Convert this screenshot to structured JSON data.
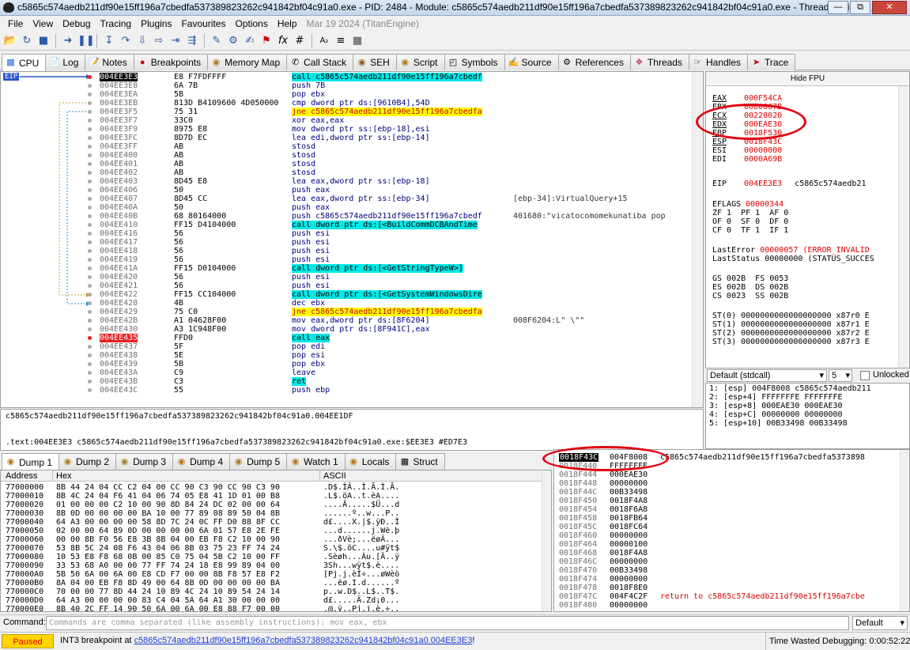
{
  "window": {
    "title": "c5865c574aedb211df90e15ff196a7cbedfa537389823262c941842bf04c91a0.exe - PID: 2484 - Module: c5865c574aedb211df90e15ff196a7cbedfa537389823262c941842bf04c91a0.exe - Thread: Main T...",
    "buttons": [
      "—",
      "⧉",
      "✕"
    ]
  },
  "menu": [
    "File",
    "View",
    "Debug",
    "Tracing",
    "Plugins",
    "Favourites",
    "Options",
    "Help"
  ],
  "menu_date": "Mar 19 2024 (TitanEngine)",
  "tabs": [
    {
      "label": "CPU",
      "icon": "cpu-icon"
    },
    {
      "label": "Log",
      "icon": "log-icon"
    },
    {
      "label": "Notes",
      "icon": "notes-icon"
    },
    {
      "label": "Breakpoints",
      "icon": "breakpoint-icon"
    },
    {
      "label": "Memory Map",
      "icon": "memory-icon"
    },
    {
      "label": "Call Stack",
      "icon": "callstack-icon"
    },
    {
      "label": "SEH",
      "icon": "seh-icon"
    },
    {
      "label": "Script",
      "icon": "script-icon"
    },
    {
      "label": "Symbols",
      "icon": "symbols-icon"
    },
    {
      "label": "Source",
      "icon": "source-icon"
    },
    {
      "label": "References",
      "icon": "references-icon"
    },
    {
      "label": "Threads",
      "icon": "threads-icon"
    },
    {
      "label": "Handles",
      "icon": "handles-icon"
    },
    {
      "label": "Trace",
      "icon": "trace-icon"
    }
  ],
  "eip_label": "EIP",
  "disasm": [
    {
      "addr": "004EE3E3",
      "bytes": "E8 F7FDFFFF",
      "instr": "call c5865c574aedb211df90e15ff196a7cbedf",
      "kind": "call",
      "cmt": "",
      "mark": "cur"
    },
    {
      "addr": "004EE3E8",
      "bytes": "6A 7B",
      "instr": "push 7B",
      "kind": "",
      "cmt": ""
    },
    {
      "addr": "004EE3EA",
      "bytes": "5B",
      "instr": "pop ebx",
      "kind": "",
      "cmt": ""
    },
    {
      "addr": "004EE3EB",
      "bytes": "813D B4109600 4D050000",
      "instr": "cmp dword ptr ds:[9610B4],54D",
      "kind": "",
      "cmt": ""
    },
    {
      "addr": "004EE3F5",
      "bytes": "75 31",
      "instr": "jne c5865c574aedb211df90e15ff196a7cbedfa",
      "kind": "jmp",
      "cmt": ""
    },
    {
      "addr": "004EE3F7",
      "bytes": "33C0",
      "instr": "xor eax,eax",
      "kind": "",
      "cmt": ""
    },
    {
      "addr": "004EE3F9",
      "bytes": "8975 E8",
      "instr": "mov dword ptr ss:[ebp-18],esi",
      "kind": "",
      "cmt": ""
    },
    {
      "addr": "004EE3FC",
      "bytes": "8D7D EC",
      "instr": "lea edi,dword ptr ss:[ebp-14]",
      "kind": "",
      "cmt": ""
    },
    {
      "addr": "004EE3FF",
      "bytes": "AB",
      "instr": "stosd",
      "kind": "",
      "cmt": ""
    },
    {
      "addr": "004EE400",
      "bytes": "AB",
      "instr": "stosd",
      "kind": "",
      "cmt": ""
    },
    {
      "addr": "004EE401",
      "bytes": "AB",
      "instr": "stosd",
      "kind": "",
      "cmt": ""
    },
    {
      "addr": "004EE402",
      "bytes": "AB",
      "instr": "stosd",
      "kind": "",
      "cmt": ""
    },
    {
      "addr": "004EE403",
      "bytes": "8D45 E8",
      "instr": "lea eax,dword ptr ss:[ebp-18]",
      "kind": "",
      "cmt": ""
    },
    {
      "addr": "004EE406",
      "bytes": "50",
      "instr": "push eax",
      "kind": "",
      "cmt": ""
    },
    {
      "addr": "004EE407",
      "bytes": "8D45 CC",
      "instr": "lea eax,dword ptr ss:[ebp-34]",
      "kind": "",
      "cmt": "[ebp-34]:VirtualQuery+15"
    },
    {
      "addr": "004EE40A",
      "bytes": "50",
      "instr": "push eax",
      "kind": "",
      "cmt": ""
    },
    {
      "addr": "004EE40B",
      "bytes": "68 80164000",
      "instr": "push c5865c574aedb211df90e15ff196a7cbedf",
      "kind": "",
      "cmt": "401680:\"vicatocomomekunatiba pop"
    },
    {
      "addr": "004EE410",
      "bytes": "FF15 D4104000",
      "instr": "call dword ptr ds:[<BuildCommDCBAndTime",
      "kind": "call",
      "cmt": ""
    },
    {
      "addr": "004EE416",
      "bytes": "56",
      "instr": "push esi",
      "kind": "",
      "cmt": ""
    },
    {
      "addr": "004EE417",
      "bytes": "56",
      "instr": "push esi",
      "kind": "",
      "cmt": ""
    },
    {
      "addr": "004EE418",
      "bytes": "56",
      "instr": "push esi",
      "kind": "",
      "cmt": ""
    },
    {
      "addr": "004EE419",
      "bytes": "56",
      "instr": "push esi",
      "kind": "",
      "cmt": ""
    },
    {
      "addr": "004EE41A",
      "bytes": "FF15 D0104000",
      "instr": "call dword ptr ds:[<GetStringTypeW>]",
      "kind": "call",
      "cmt": ""
    },
    {
      "addr": "004EE420",
      "bytes": "56",
      "instr": "push esi",
      "kind": "",
      "cmt": ""
    },
    {
      "addr": "004EE421",
      "bytes": "56",
      "instr": "push esi",
      "kind": "",
      "cmt": ""
    },
    {
      "addr": "004EE422",
      "bytes": "FF15 CC104000",
      "instr": "call dword ptr ds:[<GetSystemWindowsDire",
      "kind": "call",
      "cmt": ""
    },
    {
      "addr": "004EE428",
      "bytes": "4B",
      "instr": "dec ebx",
      "kind": "",
      "cmt": ""
    },
    {
      "addr": "004EE429",
      "bytes": "75 C0",
      "instr": "jne c5865c574aedb211df90e15ff196a7cbedfa",
      "kind": "jmp",
      "cmt": ""
    },
    {
      "addr": "004EE42B",
      "bytes": "A1 04628F00",
      "instr": "mov eax,dword ptr ds:[8F6204]",
      "kind": "",
      "cmt": "008F6204:L\" \\\"\""
    },
    {
      "addr": "004EE430",
      "bytes": "A3 1C948F00",
      "instr": "mov dword ptr ds:[8F941C],eax",
      "kind": "",
      "cmt": ""
    },
    {
      "addr": "004EE435",
      "bytes": "FFD0",
      "instr": "call eax",
      "kind": "call",
      "cmt": "",
      "mark": "bp"
    },
    {
      "addr": "004EE437",
      "bytes": "5F",
      "instr": "pop edi",
      "kind": "",
      "cmt": ""
    },
    {
      "addr": "004EE438",
      "bytes": "5E",
      "instr": "pop esi",
      "kind": "",
      "cmt": ""
    },
    {
      "addr": "004EE439",
      "bytes": "5B",
      "instr": "pop ebx",
      "kind": "",
      "cmt": ""
    },
    {
      "addr": "004EE43A",
      "bytes": "C9",
      "instr": "leave",
      "kind": "",
      "cmt": ""
    },
    {
      "addr": "004EE43B",
      "bytes": "C3",
      "instr": "ret",
      "kind": "ret",
      "cmt": ""
    },
    {
      "addr": "004EE43C",
      "bytes": "55",
      "instr": "push ebp",
      "kind": "",
      "cmt": ""
    }
  ],
  "info": {
    "line1": "c5865c574aedb211df90e15ff196a7cbedfa537389823262c941842bf04c91a0.004EE1DF",
    "line2": ".text:004EE3E3 c5865c574aedb211df90e15ff196a7cbedfa537389823262c941842bf04c91a0.exe:$EE3E3 #ED7E3"
  },
  "fpu_toggle": "Hide FPU",
  "registers": [
    {
      "name": "EAX",
      "value": "000F54CA",
      "extra": ""
    },
    {
      "name": "EBX",
      "value": "0000007B",
      "extra": ""
    },
    {
      "name": "ECX",
      "value": "00220020",
      "extra": ""
    },
    {
      "name": "EDX",
      "value": "000EAE30",
      "extra": ""
    },
    {
      "name": "EBP",
      "value": "0018F530",
      "extra": ""
    },
    {
      "name": "ESP",
      "value": "0018F43C",
      "extra": ""
    },
    {
      "name": "ESI",
      "value": "00000000",
      "extra": ""
    },
    {
      "name": "EDI",
      "value": "0000A69B",
      "extra": ""
    },
    {
      "name": "EIP",
      "value": "004EE3E3",
      "extra": "c5865c574aedb21"
    }
  ],
  "eflags": {
    "name": "EFLAGS",
    "value": "00000344"
  },
  "flags": [
    "ZF 1  PF 1  AF 0",
    "OF 0  SF 0  DF 0",
    "CF 0  TF 1  IF 1"
  ],
  "last_error": {
    "name": "LastError",
    "value": "00000057",
    "extra": "(ERROR_INVALID"
  },
  "last_status": {
    "name": "LastStatus",
    "value": "00000000",
    "extra": "(STATUS_SUCCES"
  },
  "segments": [
    "GS 002B  FS 0053",
    "ES 002B  DS 002B",
    "CS 0023  SS 002B"
  ],
  "fpu": [
    "ST(0) 0000000000000000000 x87r0 E",
    "ST(1) 0000000000000000000 x87r1 E",
    "ST(2) 0000000000000000000 x87r2 E",
    "ST(3) 0000000000000000000 x87r3 E"
  ],
  "callconv": {
    "value": "Default (stdcall)",
    "count": "5",
    "unlocked": "Unlocked"
  },
  "args": [
    "1: [esp] 004F8008 c5865c574aedb211",
    "2: [esp+4] FFFFFFFE FFFFFFFE",
    "3: [esp+8] 000EAE30 000EAE30",
    "4: [esp+C] 00000000 00000000",
    "5: [esp+10] 00B33498 00B33498"
  ],
  "dump_tabs": [
    "Dump 1",
    "Dump 2",
    "Dump 3",
    "Dump 4",
    "Dump 5",
    "Watch 1",
    "Locals",
    "Struct"
  ],
  "dump_headers": {
    "address": "Address",
    "hex": "Hex",
    "ascii": "ASCII"
  },
  "dump": [
    {
      "a": "77000000",
      "h": "8B 44 24 04 CC C2 04 00 CC 90 C3 90 CC 90 C3 90",
      "s": ".D$.ÌÂ..Ì.Ã.Ì.Ã."
    },
    {
      "a": "77000010",
      "h": "8B 4C 24 04 F6 41 04 06 74 05 E8 41 1D 01 00 B8",
      "s": ".L$.öA..t.èA...."
    },
    {
      "a": "77000020",
      "h": "01 00 00 00 C2 10 00 90 8D 84 24 DC 02 00 00 64",
      "s": "....Â.....$Ü...d"
    },
    {
      "a": "77000030",
      "h": "8B 0D 00 00 00 00 BA 10 00 77 89 08 89 50 04 8B",
      "s": "......º..w...P.."
    },
    {
      "a": "77000040",
      "h": "64 A3 00 00 00 00 58 8D 7C 24 0C FF D0 88 8F CC",
      "s": "d£....X.|$.ÿÐ..Ì"
    },
    {
      "a": "77000050",
      "h": "02 00 00 64 89 0D 00 00 00 00 6A 01 57 E8 2E FE",
      "s": "...d......j.Wè.þ"
    },
    {
      "a": "77000060",
      "h": "00 00 8B F0 56 E8 3B 8B 04 00 EB F8 C2 10 00 90",
      "s": "...ðVè;...ëøÂ..."
    },
    {
      "a": "77000070",
      "h": "53 8B 5C 24 08 F6 43 04 06 8B 03 75 23 FF 74 24",
      "s": "S.\\$.öC....u#ÿt$"
    },
    {
      "a": "77000080",
      "h": "10 53 E8 F8 68 0B 00 85 C0 75 04 5B C2 10 00 FF",
      "s": ".Sèøh...Àu.[Â..ÿ"
    },
    {
      "a": "77000090",
      "h": "33 53 68 A0 00 00 77 FF 74 24 18 E8 99 89 04 00",
      "s": "3Sh...wÿt$.è...."
    },
    {
      "a": "770000A0",
      "h": "5B 50 6A 00 6A 00 E8 CD F7 00 00 8B F8 57 E8 F2",
      "s": "[Pj.j.èÍ÷...øWèò"
    },
    {
      "a": "770000B0",
      "h": "8A 04 00 EB F8 8D 49 00 64 8B 0D 00 00 00 00 BA",
      "s": "...ëø.I.d......º"
    },
    {
      "a": "770000C0",
      "h": "70 00 00 77 8D 44 24 10 89 4C 24 10 89 54 24 14",
      "s": "p..w.D$..L$..T$."
    },
    {
      "a": "770000D0",
      "h": "64 A3 00 00 00 00 83 C4 04 5A 64 A1 30 00 00 00",
      "s": "d£.....Ä.Zd¡0..."
    },
    {
      "a": "770000E0",
      "h": "8B 40 2C FF 14 90 50 6A 00 6A 00 E8 88 F7 00 00",
      "s": ".@,ÿ..Pj.j.è.÷.."
    }
  ],
  "stack": [
    {
      "a": "0018F43C",
      "v": "004F8008",
      "c": "c5865c574aedb211df90e15ff196a7cbedfa5373898"
    },
    {
      "a": "0018F440",
      "v": "FFFFFFFE",
      "c": ""
    },
    {
      "a": "0018F444",
      "v": "000EAE30",
      "c": ""
    },
    {
      "a": "0018F448",
      "v": "00000000",
      "c": ""
    },
    {
      "a": "0018F44C",
      "v": "00B33498",
      "c": ""
    },
    {
      "a": "0018F450",
      "v": "0018F4A8",
      "c": ""
    },
    {
      "a": "0018F454",
      "v": "0018F6A8",
      "c": ""
    },
    {
      "a": "0018F458",
      "v": "0018FB64",
      "c": ""
    },
    {
      "a": "0018F45C",
      "v": "0018FC64",
      "c": ""
    },
    {
      "a": "0018F460",
      "v": "00000000",
      "c": ""
    },
    {
      "a": "0018F464",
      "v": "00000100",
      "c": ""
    },
    {
      "a": "0018F468",
      "v": "0018F4A8",
      "c": ""
    },
    {
      "a": "0018F46C",
      "v": "00000000",
      "c": ""
    },
    {
      "a": "0018F470",
      "v": "00B33498",
      "c": ""
    },
    {
      "a": "0018F474",
      "v": "00000000",
      "c": ""
    },
    {
      "a": "0018F478",
      "v": "0018F8E0",
      "c": ""
    },
    {
      "a": "0018F47C",
      "v": "004F4C2F",
      "c": "return to c5865c574aedb211df90e15ff196a7cbe"
    },
    {
      "a": "0018F480",
      "v": "00000000",
      "c": ""
    }
  ],
  "command": {
    "label": "Command:",
    "placeholder": "Commands are comma separated (like assembly instructions): mov eax, ebx",
    "mode": "Default"
  },
  "status": {
    "state": "Paused",
    "message_prefix": "INT3 breakpoint at ",
    "message_link": "c5865c574aedb211df90e15ff196a7cbedfa537389823262c941842bf04c91a0.004EE3E3",
    "message_suffix": "!",
    "time": "Time Wasted Debugging: 0:00:52:22"
  },
  "colors": {
    "annotation_circle": "#e00010",
    "paused_bg": "#ffd400",
    "call_bg": "#00e8e8",
    "jump_bg": "#ffff00",
    "bp_red": "#e81e1e"
  }
}
